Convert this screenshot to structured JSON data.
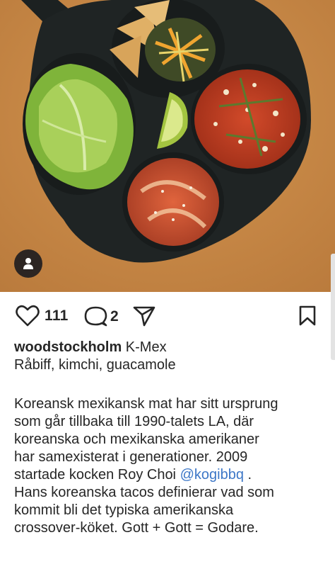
{
  "post": {
    "image_alt": "Cast-iron pan with lettuce, tortilla chips with slaw, lime wedge, spicy beef with scallions and kimchi with sesame on orange background",
    "likes": "111",
    "comments": "2",
    "author": "woodstockholm",
    "caption_title": "K-Mex",
    "caption_line2": "Råbiff, kimchi, guacamole",
    "body_lines": [
      "Koreansk mexikansk mat har sitt ursprung",
      "som går tillbaka till 1990-talets LA, där",
      "koreanska och mexikanska amerikaner",
      "har samexisterat i generationer. 2009",
      "startade kocken Roy Choi"
    ],
    "mention": "@kogibbq",
    "after_mention": ".",
    "body_lines_2": [
      "Hans koreanska tacos definierar vad som",
      "kommit bli det typiska amerikanska",
      "crossover-köket. Gott + Gott = Godare."
    ]
  },
  "icons": {
    "like": "heart-icon",
    "comment": "comment-bubble-icon",
    "share": "paper-plane-icon",
    "save": "bookmark-icon",
    "tags": "user-tag-icon"
  },
  "colors": {
    "background_photo": "#c98a46",
    "pan": "#1f2424",
    "mention": "#3d77c7",
    "text": "#262626"
  }
}
